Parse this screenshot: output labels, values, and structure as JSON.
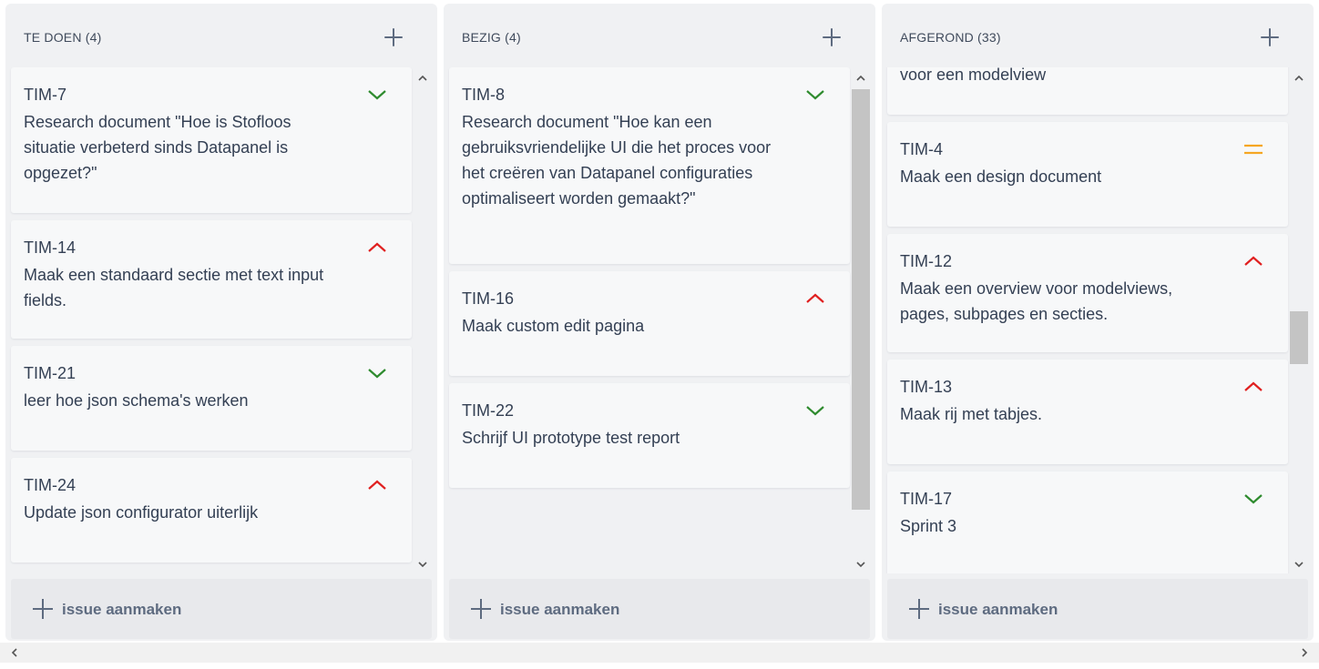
{
  "colors": {
    "priority_low": "#2e8b2e",
    "priority_high": "#e02020",
    "priority_medium": "#f5a623",
    "column_bg": "#f0f1f3",
    "card_bg": "#f7f8f9"
  },
  "columns": [
    {
      "title": "TE DOEN (4)",
      "create_label": "issue aanmaken",
      "cards": [
        {
          "key": "TIM-7",
          "summary": "Research document \"Hoe is Stofloos situatie verbeterd sinds Datapanel is opgezet?\"",
          "priority": "low"
        },
        {
          "key": "TIM-14",
          "summary": "Maak een standaard sectie met text input fields.",
          "priority": "high"
        },
        {
          "key": "TIM-21",
          "summary": "leer hoe json schema's werken",
          "priority": "low"
        },
        {
          "key": "TIM-24",
          "summary": "Update json configurator uiterlijk",
          "priority": "high"
        }
      ]
    },
    {
      "title": "BEZIG (4)",
      "create_label": "issue aanmaken",
      "cards": [
        {
          "key": "TIM-8",
          "summary": "Research document \"Hoe kan een gebruiksvriendelijke UI die het proces voor het creëren van Datapanel configuraties optimaliseert worden gemaakt?\"",
          "priority": "low"
        },
        {
          "key": "TIM-16",
          "summary": "Maak custom edit pagina",
          "priority": "high"
        },
        {
          "key": "TIM-22",
          "summary": "Schrijf UI prototype test report",
          "priority": "low"
        }
      ]
    },
    {
      "title": "AFGEROND (33)",
      "create_label": "issue aanmaken",
      "cards": [
        {
          "key": "",
          "summary": "voor een modelview",
          "priority": ""
        },
        {
          "key": "TIM-4",
          "summary": "Maak een design document",
          "priority": "medium"
        },
        {
          "key": "TIM-12",
          "summary": "Maak een overview voor modelviews, pages, subpages en secties.",
          "priority": "high"
        },
        {
          "key": "TIM-13",
          "summary": "Maak rij met tabjes.",
          "priority": "high"
        },
        {
          "key": "TIM-17",
          "summary": "Sprint 3",
          "priority": "low"
        }
      ]
    }
  ]
}
